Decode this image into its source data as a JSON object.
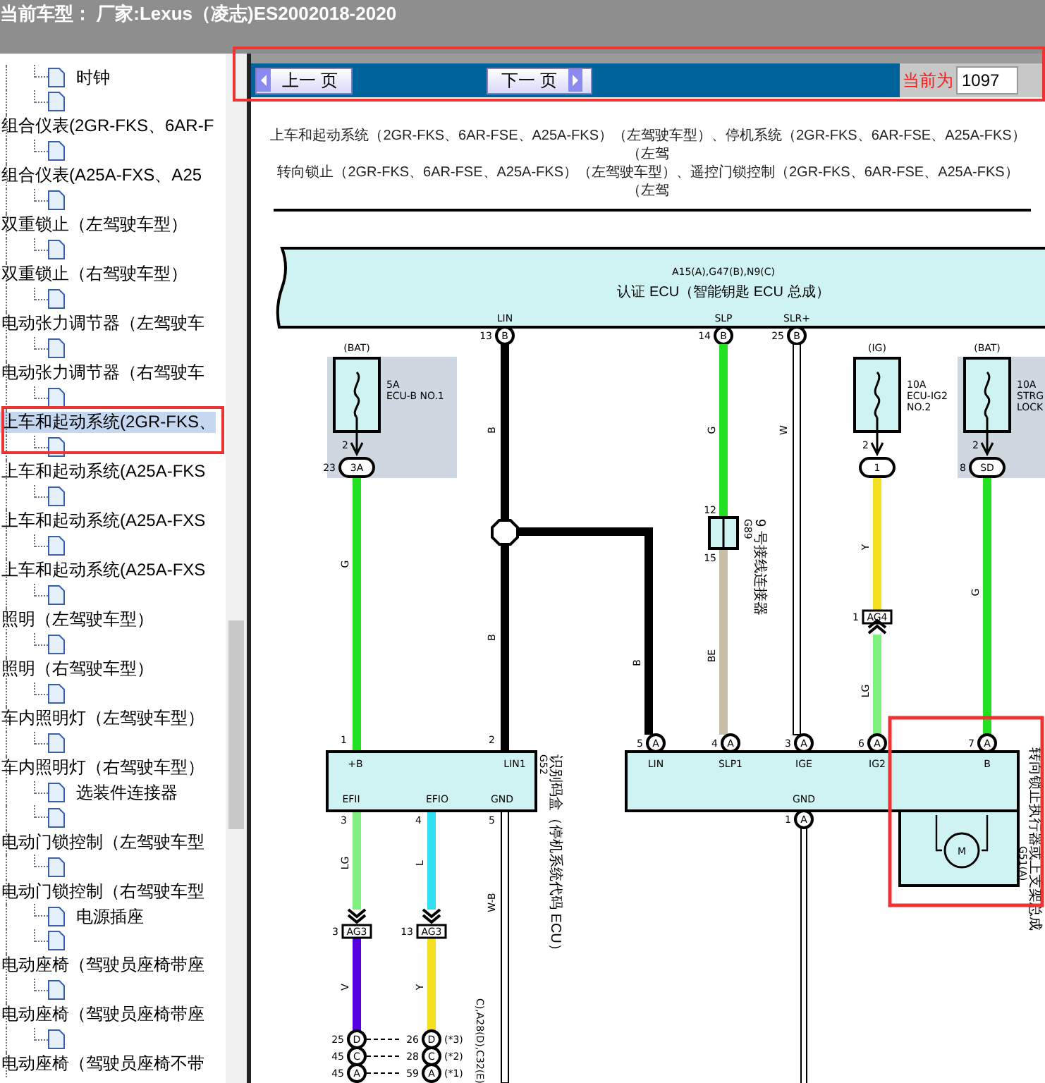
{
  "header": {
    "title": "当前车型： 厂家:Lexus（凌志)ES2002018-2020"
  },
  "sidebar": {
    "items": [
      {
        "children": [
          {
            "kind": "labeled",
            "label": "时钟"
          },
          {
            "kind": "blank"
          }
        ]
      },
      {
        "label": "组合仪表(2GR-FKS、6AR-F",
        "selected": false,
        "children": [
          {
            "kind": "blank"
          }
        ]
      },
      {
        "label": "组合仪表(A25A-FXS、A25",
        "selected": false,
        "children": [
          {
            "kind": "blank"
          }
        ]
      },
      {
        "label": "双重锁止（左驾驶车型）",
        "selected": false,
        "children": [
          {
            "kind": "blank"
          }
        ]
      },
      {
        "label": "双重锁止（右驾驶车型）",
        "selected": false,
        "children": [
          {
            "kind": "blank"
          }
        ]
      },
      {
        "label": "电动张力调节器（左驾驶车",
        "selected": false,
        "children": [
          {
            "kind": "blank"
          }
        ]
      },
      {
        "label": "电动张力调节器（右驾驶车",
        "selected": false,
        "children": [
          {
            "kind": "blank"
          }
        ]
      },
      {
        "label": "上车和起动系统(2GR-FKS、",
        "selected": true,
        "children": [
          {
            "kind": "blank"
          }
        ]
      },
      {
        "label": "上车和起动系统(A25A-FKS",
        "selected": false,
        "children": [
          {
            "kind": "blank"
          }
        ]
      },
      {
        "label": "上车和起动系统(A25A-FXS",
        "selected": false,
        "children": [
          {
            "kind": "blank"
          }
        ]
      },
      {
        "label": "上车和起动系统(A25A-FXS",
        "selected": false,
        "children": [
          {
            "kind": "blank"
          }
        ]
      },
      {
        "label": "照明（左驾驶车型）",
        "selected": false,
        "children": [
          {
            "kind": "blank"
          }
        ]
      },
      {
        "label": "照明（右驾驶车型）",
        "selected": false,
        "children": [
          {
            "kind": "blank"
          }
        ]
      },
      {
        "label": "车内照明灯（左驾驶车型）",
        "selected": false,
        "children": [
          {
            "kind": "blank"
          }
        ]
      },
      {
        "label": "车内照明灯（右驾驶车型）",
        "selected": false,
        "children": [
          {
            "kind": "labeled",
            "label": "选装件连接器"
          },
          {
            "kind": "blank"
          }
        ]
      },
      {
        "label": "电动门锁控制（左驾驶车型",
        "selected": false,
        "children": [
          {
            "kind": "blank"
          }
        ]
      },
      {
        "label": "电动门锁控制（右驾驶车型",
        "selected": false,
        "children": [
          {
            "kind": "labeled",
            "label": "电源插座"
          },
          {
            "kind": "blank"
          }
        ]
      },
      {
        "label": "电动座椅（驾驶员座椅带座",
        "selected": false,
        "children": [
          {
            "kind": "blank"
          }
        ]
      },
      {
        "label": "电动座椅（驾驶员座椅带座",
        "selected": false,
        "children": [
          {
            "kind": "blank"
          }
        ]
      },
      {
        "label": "电动座椅（驾驶员座椅不带",
        "selected": false
      }
    ]
  },
  "nav": {
    "prev": "上一 页",
    "next": "下一 页",
    "current_label": "当前为",
    "current_page": "1097"
  },
  "diagram": {
    "title_lines": [
      "上车和起动系统（2GR-FKS、6AR-FSE、A25A-FKS）（左驾驶车型）、停机系统（2GR-FKS、6AR-FSE、A25A-FKS）（左驾",
      "转向锁止（2GR-FKS、6AR-FSE、A25A-FKS）（左驾驶车型）、遥控门锁控制（2GR-FKS、6AR-FSE、A25A-FKS）（左驾"
    ],
    "ecu": {
      "connectors": "A15(A),G47(B),N9(C)",
      "name": "认证 ECU（智能钥匙 ECU 总成）",
      "pins": [
        {
          "label": "LIN",
          "number": "13",
          "connector": "B"
        },
        {
          "label": "SLP",
          "number": "14",
          "connector": "B"
        },
        {
          "label": "SLR+",
          "number": "25",
          "connector": "B"
        }
      ]
    },
    "fuses": [
      {
        "source": "(BAT)",
        "lines": [
          "5A",
          "ECU-B NO.1"
        ],
        "pin": "2",
        "connector": "3A",
        "connector_pin": "23"
      },
      {
        "source": "(IG)",
        "lines": [
          "10A",
          "ECU-IG2",
          "NO.2"
        ],
        "pin": "2",
        "connector": "1"
      },
      {
        "source": "(BAT)",
        "lines": [
          "10A",
          "STRG",
          "LOCK"
        ],
        "pin": "2",
        "connector": "SD",
        "connector_pin": "8"
      }
    ],
    "wires": [
      {
        "label": "G",
        "color": "#22e022"
      },
      {
        "label": "B",
        "color": "#000000"
      },
      {
        "label": "B",
        "color": "#000000"
      },
      {
        "label": "B",
        "color": "#000000"
      },
      {
        "label": "G",
        "color": "#22e022"
      },
      {
        "label": "BE",
        "color": "#c8bea8"
      },
      {
        "label": "W",
        "color": "#ffffff"
      },
      {
        "label": "Y",
        "color": "#f5e020"
      },
      {
        "label": "LG",
        "color": "#80f080"
      },
      {
        "label": "G",
        "color": "#22e022"
      },
      {
        "label": "LG",
        "color": "#80f080"
      },
      {
        "label": "L",
        "color": "#30e0f0"
      },
      {
        "label": "W-B",
        "color": "#ffffff"
      },
      {
        "label": "V",
        "color": "#5500e0"
      },
      {
        "label": "Y",
        "color": "#f5e020"
      }
    ],
    "junction_connector": {
      "upper_pin": "12",
      "lower_pin": "15",
      "code": "G89",
      "name": "9 号接线连接器"
    },
    "inline_connectors": [
      {
        "code": "AG4",
        "pin": "1"
      },
      {
        "code": "AG3",
        "pin": "3"
      },
      {
        "code": "AG3",
        "pin": "13"
      }
    ],
    "id_box": {
      "code": "G52",
      "name": "识别码盒（停机系统代码 ECU）",
      "pins": [
        {
          "label": "+B",
          "number": "1"
        },
        {
          "label": "LIN1",
          "number": "2"
        },
        {
          "label": "EFII",
          "number": "3"
        },
        {
          "label": "EFIO",
          "number": "4"
        },
        {
          "label": "GND",
          "number": "5"
        }
      ]
    },
    "actuator": {
      "code": "G51(A)",
      "name": "转向锁止执行器或上支架总成",
      "motor": "M",
      "pins": [
        {
          "label": "LIN",
          "number": "5",
          "connector": "A"
        },
        {
          "label": "SLP1",
          "number": "4",
          "connector": "A"
        },
        {
          "label": "IGE",
          "number": "3",
          "connector": "A"
        },
        {
          "label": "IG2",
          "number": "6",
          "connector": "A"
        },
        {
          "label": "B",
          "number": "7",
          "connector": "A"
        },
        {
          "label": "GND",
          "number": "1",
          "connector": "A"
        }
      ]
    },
    "bottom_pins": [
      {
        "left_number": "25",
        "left_connector": "D",
        "right_number": "26",
        "right_connector": "D",
        "note": "(*3)"
      },
      {
        "left_number": "45",
        "left_connector": "C",
        "right_number": "28",
        "right_connector": "C",
        "note": "(*2)"
      },
      {
        "left_number": "45",
        "left_connector": "A",
        "right_number": "59",
        "right_connector": "A",
        "note": "(*1)"
      }
    ],
    "bottom_connector_label": "C),A28(D),C32(E)"
  }
}
